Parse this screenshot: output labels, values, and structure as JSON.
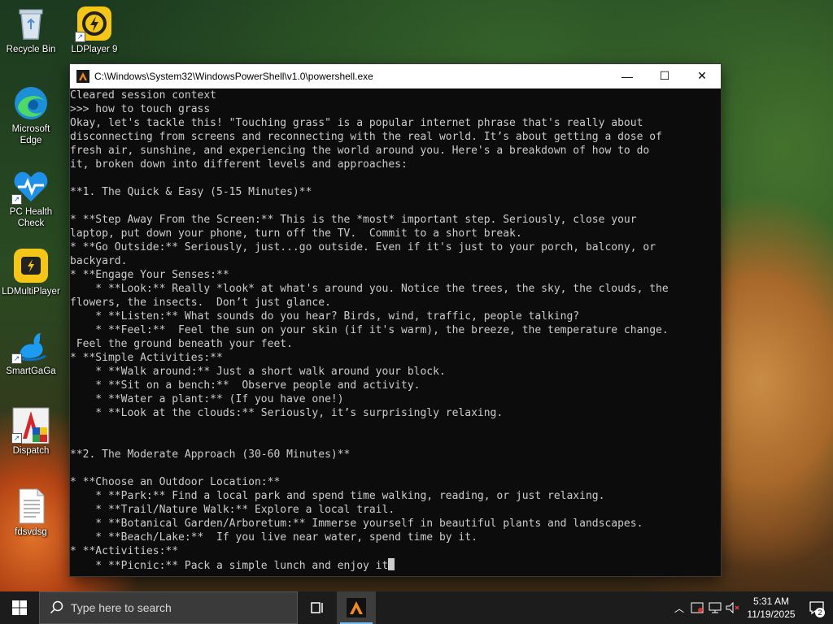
{
  "desktop_icons": [
    {
      "label": "Recycle Bin",
      "icon": "recycle-bin-icon"
    },
    {
      "label": "LDPlayer 9",
      "icon": "ldplayer-icon"
    },
    {
      "label": "Microsoft Edge",
      "icon": "edge-icon"
    },
    {
      "label": "PC Health Check",
      "icon": "pc-health-check-icon"
    },
    {
      "label": "LDMultiPlayer",
      "icon": "ldmultiplayer-icon"
    },
    {
      "label": "SmartGaGa",
      "icon": "smartgaga-icon"
    },
    {
      "label": "Dispatch",
      "icon": "dispatch-icon"
    },
    {
      "label": "fdsvdsg",
      "icon": "text-file-icon"
    }
  ],
  "window": {
    "title": "C:\\Windows\\System32\\WindowsPowerShell\\v1.0\\powershell.exe",
    "minimize_glyph": "—",
    "maximize_glyph": "☐",
    "close_glyph": "✕"
  },
  "console": {
    "lines": [
      "Cleared session context",
      ">>> how to touch grass",
      "Okay, let's tackle this! \"Touching grass\" is a popular internet phrase that's really about",
      "disconnecting from screens and reconnecting with the real world. It’s about getting a dose of",
      "fresh air, sunshine, and experiencing the world around you. Here's a breakdown of how to do",
      "it, broken down into different levels and approaches:",
      "",
      "**1. The Quick & Easy (5-15 Minutes)**",
      "",
      "* **Step Away From the Screen:** This is the *most* important step. Seriously, close your",
      "laptop, put down your phone, turn off the TV.  Commit to a short break.",
      "* **Go Outside:** Seriously, just...go outside. Even if it's just to your porch, balcony, or",
      "backyard.",
      "* **Engage Your Senses:**",
      "    * **Look:** Really *look* at what's around you. Notice the trees, the sky, the clouds, the",
      "flowers, the insects.  Don’t just glance.",
      "    * **Listen:** What sounds do you hear? Birds, wind, traffic, people talking?",
      "    * **Feel:**  Feel the sun on your skin (if it's warm), the breeze, the temperature change.",
      " Feel the ground beneath your feet.",
      "* **Simple Activities:**",
      "    * **Walk around:** Just a short walk around your block.",
      "    * **Sit on a bench:**  Observe people and activity.",
      "    * **Water a plant:** (If you have one!)",
      "    * **Look at the clouds:** Seriously, it’s surprisingly relaxing.",
      "",
      "",
      "**2. The Moderate Approach (30-60 Minutes)**",
      "",
      "* **Choose an Outdoor Location:**",
      "    * **Park:** Find a local park and spend time walking, reading, or just relaxing.",
      "    * **Trail/Nature Walk:** Explore a local trail.",
      "    * **Botanical Garden/Arboretum:** Immerse yourself in beautiful plants and landscapes.",
      "    * **Beach/Lake:**  If you live near water, spend time by it.",
      "* **Activities:**",
      "    * **Picnic:** Pack a simple lunch and enjoy it"
    ]
  },
  "taskbar": {
    "search_placeholder": "Type here to search",
    "clock_time": "5:31 AM",
    "clock_date": "11/19/2025",
    "notification_count": "2"
  }
}
